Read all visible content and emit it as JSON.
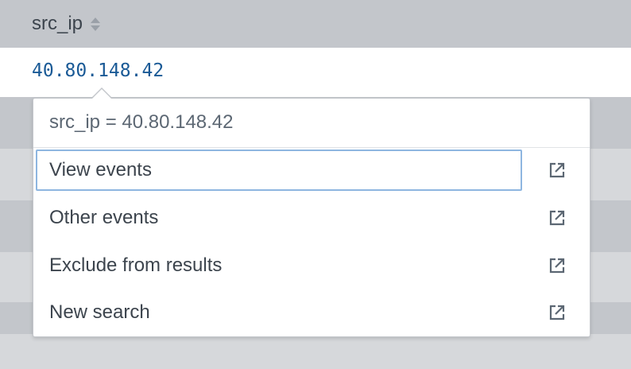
{
  "table": {
    "column_header": "src_ip",
    "cell_value": "40.80.148.42"
  },
  "popup": {
    "title": "src_ip = 40.80.148.42",
    "items": [
      {
        "label": "View events",
        "icon": "external-link-icon",
        "focused": true
      },
      {
        "label": "Other events",
        "icon": "external-link-icon"
      },
      {
        "label": "Exclude from results",
        "icon": "external-link-icon"
      },
      {
        "label": "New search",
        "icon": "external-link-icon"
      }
    ]
  },
  "colors": {
    "link": "#1a5a96",
    "focus_border": "#8eb6e0",
    "header_bg": "#c3c6cb"
  }
}
